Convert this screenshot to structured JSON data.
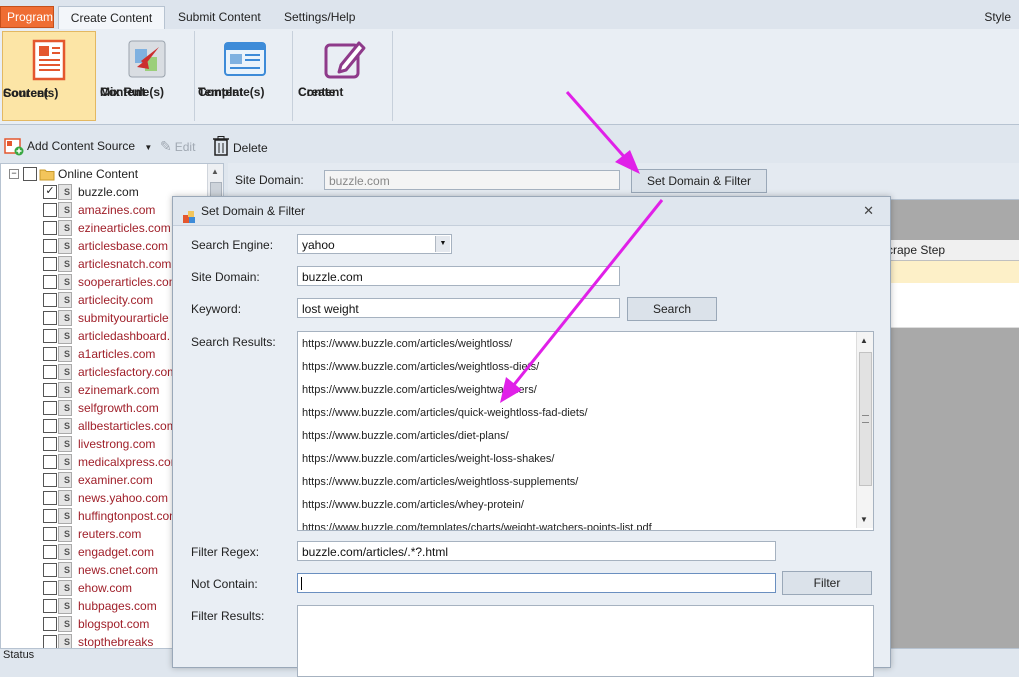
{
  "menu": {
    "program": "Program",
    "create": "Create Content",
    "submit": "Submit Content",
    "settings": "Settings/Help",
    "style": "Style"
  },
  "ribbon": [
    {
      "label1": "Content",
      "label2": "Source(s)",
      "icon": "content-source-icon",
      "active": true
    },
    {
      "label1": "Content",
      "label2": "Mix Rule(s)",
      "icon": "mix-rule-icon"
    },
    {
      "label1": "Content",
      "label2": "Template(s)",
      "icon": "template-icon"
    },
    {
      "label1": "Create",
      "label2": "Content",
      "icon": "edit-pencil-icon"
    }
  ],
  "toolbar": {
    "add": "Add Content Source",
    "edit": "Edit",
    "delete": "Delete"
  },
  "tree": {
    "root": "Online Content",
    "items": [
      "buzzle.com",
      "amazines.com",
      "ezinearticles.com",
      "articlesbase.com",
      "articlesnatch.com",
      "sooperarticles.com",
      "articlecity.com",
      "submityourarticle",
      "articledashboard.",
      "a1articles.com",
      "articlesfactory.com",
      "ezinemark.com",
      "selfgrowth.com",
      "allbestarticles.com",
      "livestrong.com",
      "medicalxpress.com",
      "examiner.com",
      "news.yahoo.com",
      "huffingtonpost.com",
      "reuters.com",
      "engadget.com",
      "news.cnet.com",
      "ehow.com",
      "hubpages.com",
      "blogspot.com",
      "stopthebreaks"
    ]
  },
  "domain_strip": {
    "label": "Site Domain:",
    "value": "buzzle.com",
    "button": "Set Domain & Filter"
  },
  "grid": {
    "header": "crape Step"
  },
  "status": "Status",
  "dialog": {
    "title": "Set Domain & Filter",
    "engine_label": "Search Engine:",
    "engine_value": "yahoo",
    "domain_label": "Site Domain:",
    "domain_value": "buzzle.com",
    "keyword_label": "Keyword:",
    "keyword_value": "lost weight",
    "search_button": "Search",
    "results_label": "Search Results:",
    "results": [
      "https://www.buzzle.com/articles/weightloss/",
      "https://www.buzzle.com/articles/weightloss-diets/",
      "https://www.buzzle.com/articles/weightwatchers/",
      "https://www.buzzle.com/articles/quick-weightloss-fad-diets/",
      "https://www.buzzle.com/articles/diet-plans/",
      "https://www.buzzle.com/articles/weight-loss-shakes/",
      "https://www.buzzle.com/articles/weightloss-supplements/",
      "https://www.buzzle.com/articles/whey-protein/",
      "https://www.buzzle.com/templates/charts/weight-watchers-points-list.pdf"
    ],
    "filter_regex_label": "Filter Regex:",
    "filter_regex_value": "buzzle.com/articles/.*?.html",
    "not_contain_label": "Not Contain:",
    "not_contain_value": "",
    "filter_button": "Filter",
    "filter_results_label": "Filter Results:"
  },
  "colors": {
    "accent_orange": "#ef6d33",
    "arrow_magenta": "#e020e8",
    "site_red": "#a0202a"
  }
}
